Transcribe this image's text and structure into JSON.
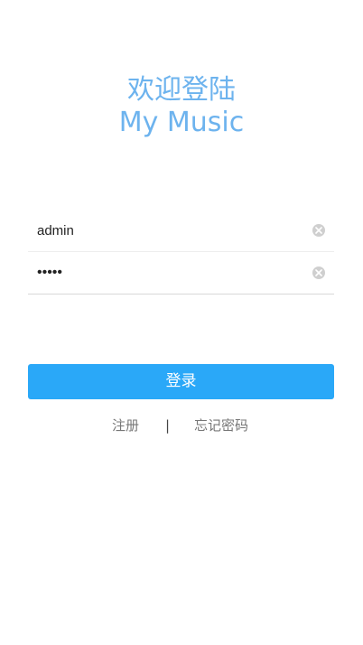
{
  "header": {
    "welcome": "欢迎登陆",
    "app_name": "My Music"
  },
  "form": {
    "username_value": "admin",
    "password_value": "•••••",
    "clear_icon": "clear-circle-icon"
  },
  "actions": {
    "login_label": "登录",
    "register_label": "注册",
    "separator": "|",
    "forgot_label": "忘记密码"
  },
  "colors": {
    "title": "#6db3ee",
    "button": "#2aa8f8",
    "link": "#777777"
  }
}
